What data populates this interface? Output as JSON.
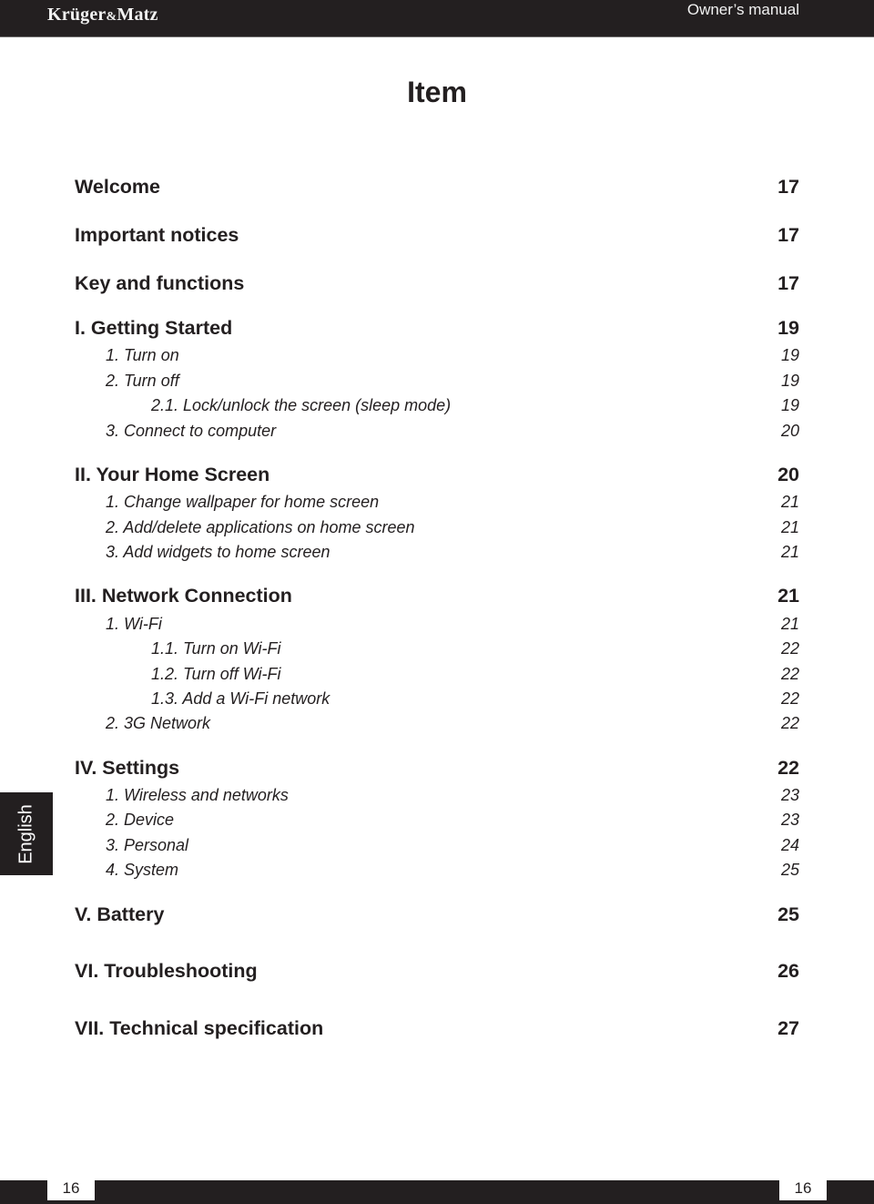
{
  "header": {
    "brand": {
      "name_part1": "Krüger",
      "amp": "&",
      "name_part2": "Matz"
    },
    "document_type": "Owner’s manual"
  },
  "title": "Item",
  "toc": [
    {
      "level": 1,
      "label": "Welcome",
      "page": "17"
    },
    {
      "level": 1,
      "label": "Important notices",
      "page": "17"
    },
    {
      "level": 1,
      "label": "Key and functions",
      "page": "17"
    },
    {
      "level": 1,
      "label": "I. Getting Started",
      "page": "19"
    },
    {
      "level": 2,
      "label": "1. Turn on",
      "page": "19"
    },
    {
      "level": 2,
      "label": "2. Turn off",
      "page": "19"
    },
    {
      "level": 3,
      "label": "2.1. Lock/unlock the screen (sleep mode)",
      "page": "19"
    },
    {
      "level": 2,
      "label": "3. Connect to computer",
      "page": "20"
    },
    {
      "level": 1,
      "label": "II. Your Home Screen",
      "page": "20"
    },
    {
      "level": 2,
      "label": "1. Change wallpaper for home screen",
      "page": "21"
    },
    {
      "level": 2,
      "label": "2. Add/delete applications on home screen",
      "page": "21"
    },
    {
      "level": 2,
      "label": "3. Add widgets to home screen",
      "page": "21"
    },
    {
      "level": 1,
      "label": "III. Network Connection",
      "page": "21"
    },
    {
      "level": 2,
      "label": "1. Wi-Fi",
      "page": "21"
    },
    {
      "level": 3,
      "label": "1.1. Turn on Wi-Fi",
      "page": "22"
    },
    {
      "level": 3,
      "label": "1.2. Turn off Wi-Fi",
      "page": "22"
    },
    {
      "level": 3,
      "label": "1.3. Add a Wi-Fi network",
      "page": "22"
    },
    {
      "level": 2,
      "label": "2. 3G Network",
      "page": "22"
    },
    {
      "level": 1,
      "label": "IV. Settings",
      "page": "22"
    },
    {
      "level": 2,
      "label": "1. Wireless and networks",
      "page": "23"
    },
    {
      "level": 2,
      "label": "2. Device",
      "page": "23"
    },
    {
      "level": 2,
      "label": "3. Personal",
      "page": "24"
    },
    {
      "level": 2,
      "label": "4. System",
      "page": "25"
    },
    {
      "level": 1,
      "label": "V. Battery",
      "page": "25"
    },
    {
      "level": 1,
      "label": "VI. Troubleshooting",
      "page": "26"
    },
    {
      "level": 1,
      "label": "VII. Technical specification",
      "page": "27"
    }
  ],
  "side_tab": {
    "language": "English"
  },
  "footer": {
    "page_left": "16",
    "page_right": "16"
  },
  "colors": {
    "dark": "#231f20",
    "light": "#ffffff"
  }
}
